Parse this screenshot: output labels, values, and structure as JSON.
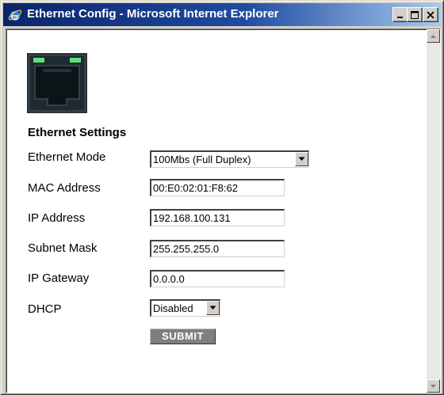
{
  "window": {
    "title": "Ethernet Config - Microsoft Internet Explorer",
    "title_icon": "internet-explorer-icon",
    "buttons": [
      "minimize-icon",
      "maximize-icon",
      "close-icon"
    ]
  },
  "page": {
    "port_icon": "ethernet-port-icon",
    "section_title": "Ethernet Settings",
    "fields": {
      "ethernet_mode": {
        "label": "Ethernet Mode",
        "value": "100Mbs (Full Duplex)"
      },
      "mac_address": {
        "label": "MAC Address",
        "value": "00:E0:02:01:F8:62"
      },
      "ip_address": {
        "label": "IP Address",
        "value": "192.168.100.131"
      },
      "subnet_mask": {
        "label": "Subnet Mask",
        "value": "255.255.255.0"
      },
      "ip_gateway": {
        "label": "IP Gateway",
        "value": "0.0.0.0"
      },
      "dhcp": {
        "label": "DHCP",
        "value": "Disabled"
      }
    },
    "submit_label": "SUBMIT"
  },
  "colors": {
    "titlebar_start": "#0a246a",
    "titlebar_end": "#a6caf0",
    "window_face": "#d4d0c8",
    "submit_bg": "#7f7f7f",
    "port_led": "#5fe07a"
  }
}
